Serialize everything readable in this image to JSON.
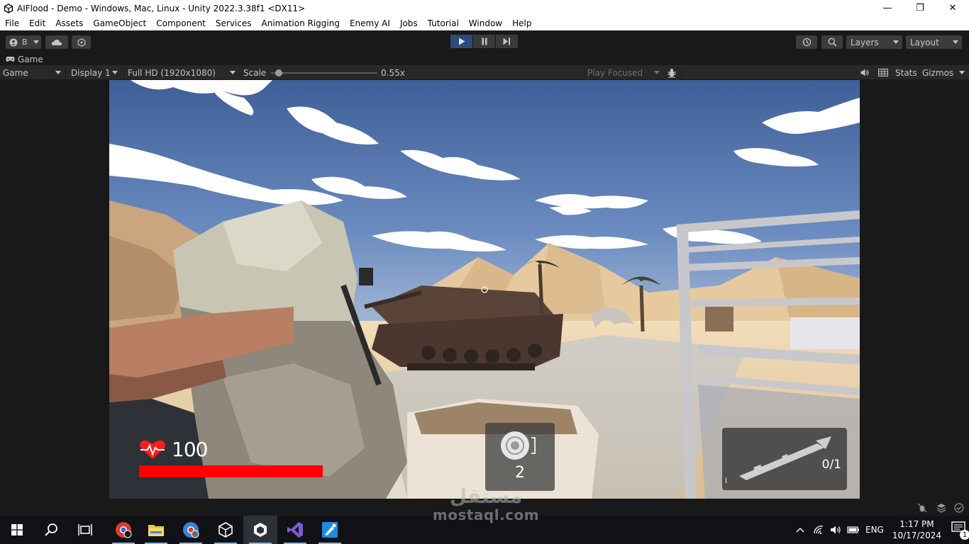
{
  "window": {
    "title": "AIFlood - Demo - Windows, Mac, Linux - Unity 2022.3.38f1 <DX11>",
    "minimize": "—",
    "maximize": "❐",
    "close": "✕"
  },
  "menu": [
    "File",
    "Edit",
    "Assets",
    "GameObject",
    "Component",
    "Services",
    "Animation Rigging",
    "Enemy AI",
    "Jobs",
    "Tutorial",
    "Window",
    "Help"
  ],
  "toolbar": {
    "account_label": "B",
    "layers_label": "Layers",
    "layout_label": "Layout",
    "play_state": "playing"
  },
  "game_tab": {
    "tab_label": "Game",
    "mode_label": "Game",
    "display_label": "Display 1",
    "resolution_label": "Full HD (1920x1080)",
    "scale_label": "Scale",
    "scale_value": "0.55x",
    "scale_fraction": 0.05,
    "play_focus_label": "Play Focused",
    "stats_label": "Stats",
    "gizmos_label": "Gizmos"
  },
  "hud": {
    "health_value": "100",
    "health_fraction": 1.0,
    "grenade_count": "2",
    "ammo": "0/1",
    "weapon_index": "i"
  },
  "watermark": {
    "arabic": "مستقل",
    "latin": "mostaql.com"
  },
  "taskbar": {
    "language": "ENG",
    "time": "1:17 PM",
    "date": "10/17/2024",
    "notification_count": "1"
  },
  "colors": {
    "health_bar": "#ff0000",
    "play_active": "#2f4a7a",
    "sky": "#4b6ea8",
    "sand": "#e8c9a0"
  }
}
